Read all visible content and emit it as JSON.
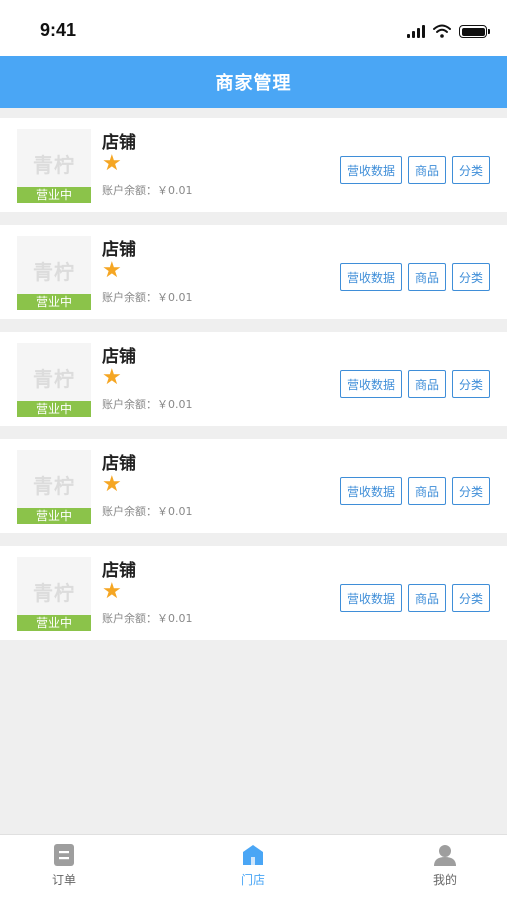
{
  "status_bar": {
    "time": "9:41"
  },
  "nav": {
    "title": "商家管理"
  },
  "stores": [
    {
      "name": "店铺",
      "status": "营业中",
      "watermark": "青柠",
      "balance": "账户余额：￥0.01",
      "actions": [
        "营收数据",
        "商品",
        "分类"
      ]
    },
    {
      "name": "店铺",
      "status": "营业中",
      "watermark": "青柠",
      "balance": "账户余额：￥0.01",
      "actions": [
        "营收数据",
        "商品",
        "分类"
      ]
    },
    {
      "name": "店铺",
      "status": "营业中",
      "watermark": "青柠",
      "balance": "账户余额：￥0.01",
      "actions": [
        "营收数据",
        "商品",
        "分类"
      ]
    },
    {
      "name": "店铺",
      "status": "营业中",
      "watermark": "青柠",
      "balance": "账户余额：￥0.01",
      "actions": [
        "营收数据",
        "商品",
        "分类"
      ]
    },
    {
      "name": "店铺",
      "status": "营业中",
      "watermark": "青柠",
      "balance": "账户余额：￥0.01",
      "actions": [
        "营收数据",
        "商品",
        "分类"
      ]
    }
  ],
  "tabs": [
    {
      "label": "订单",
      "icon": "orders-icon",
      "active": false
    },
    {
      "label": "门店",
      "icon": "store-icon",
      "active": true
    },
    {
      "label": "我的",
      "icon": "profile-icon",
      "active": false
    }
  ],
  "colors": {
    "nav_bg": "#4aa6f5",
    "active_tab": "#4aa6f5",
    "inactive_tab": "#999999",
    "status_open": "#8bc34a",
    "star": "#f5a623",
    "button": "#3f8ed8"
  }
}
